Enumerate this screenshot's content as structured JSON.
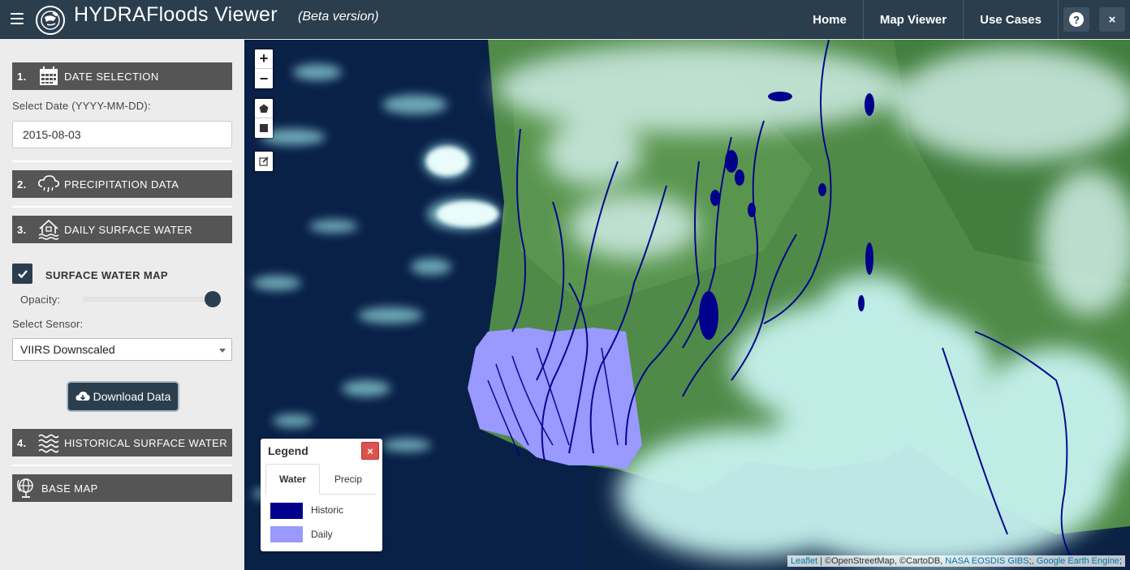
{
  "header": {
    "title": "HYDRAFloods Viewer",
    "subtitle": "(Beta version)",
    "nav": [
      "Home",
      "Map Viewer",
      "Use Cases"
    ],
    "help_label": "?",
    "close_label": "×"
  },
  "sidebar": {
    "sections": [
      {
        "num": "1.",
        "label": "DATE SELECTION",
        "icon": "calendar-icon"
      },
      {
        "num": "2.",
        "label": "PRECIPITATION DATA",
        "icon": "rain-cloud-icon"
      },
      {
        "num": "3.",
        "label": "DAILY SURFACE WATER",
        "icon": "flood-house-icon"
      },
      {
        "num": "4.",
        "label": "HISTORICAL SURFACE WATER",
        "icon": "waves-icon"
      },
      {
        "num": "",
        "label": "BASE MAP",
        "icon": "globe-icon"
      }
    ],
    "date_label": "Select Date (YYYY-MM-DD):",
    "date_value": "2015-08-03",
    "surface_map_label": "SURFACE WATER MAP",
    "surface_map_checked": true,
    "opacity_label": "Opacity:",
    "opacity_value": 1.0,
    "sensor_label": "Select Sensor:",
    "sensor_value": "VIIRS Downscaled",
    "download_label": "Download Data"
  },
  "map": {
    "zoom_in": "+",
    "zoom_out": "−",
    "legend": {
      "title": "Legend",
      "close": "×",
      "tabs": [
        "Water",
        "Precip"
      ],
      "active_tab": "Water",
      "items": [
        {
          "label": "Historic",
          "color": "#00008b"
        },
        {
          "label": "Daily",
          "color": "#9999ff"
        }
      ]
    },
    "attribution": {
      "leaflet": "Leaflet",
      "sep1": " | ©OpenStreetMap, ©CartoDB, ",
      "gibs": "NASA EOSDIS GIBS",
      "sep2": ";, ",
      "gee": "Google Earth Engine",
      "end": ";"
    }
  },
  "colors": {
    "header_bg": "#2b3e4e",
    "section_bg": "#555555",
    "historic": "#00008b",
    "daily": "#9999ff"
  }
}
